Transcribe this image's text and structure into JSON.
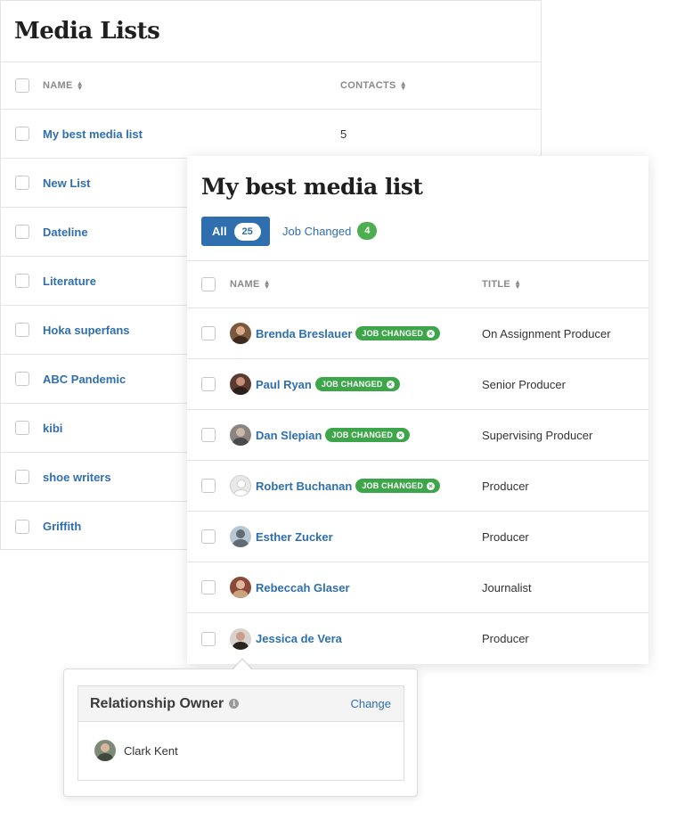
{
  "media_lists": {
    "title": "Media Lists",
    "columns": {
      "name": "NAME",
      "contacts": "CONTACTS"
    },
    "rows": [
      {
        "name": "My best media list",
        "contacts": "5"
      },
      {
        "name": "New List"
      },
      {
        "name": "Dateline"
      },
      {
        "name": "Literature"
      },
      {
        "name": "Hoka superfans"
      },
      {
        "name": "ABC Pandemic"
      },
      {
        "name": "kibi"
      },
      {
        "name": "shoe writers"
      },
      {
        "name": "Griffith"
      }
    ]
  },
  "detail": {
    "title": "My best media list",
    "tabs": {
      "all": {
        "label": "All",
        "count": "25"
      },
      "job_changed": {
        "label": "Job Changed",
        "count": "4"
      }
    },
    "columns": {
      "name": "NAME",
      "title": "TITLE"
    },
    "badge_label": "JOB CHANGED",
    "contacts": [
      {
        "name": "Brenda Breslauer",
        "title": "On Assignment Producer",
        "job_changed": true
      },
      {
        "name": "Paul Ryan",
        "title": "Senior Producer",
        "job_changed": true
      },
      {
        "name": "Dan Slepian",
        "title": "Supervising Producer",
        "job_changed": true
      },
      {
        "name": "Robert Buchanan",
        "title": "Producer",
        "job_changed": true
      },
      {
        "name": "Esther Zucker",
        "title": "Producer",
        "job_changed": false
      },
      {
        "name": "Rebeccah Glaser",
        "title": "Journalist",
        "job_changed": false
      },
      {
        "name": "Jessica de Vera",
        "title": "Producer",
        "job_changed": false
      }
    ]
  },
  "relationship": {
    "title": "Relationship Owner",
    "change_label": "Change",
    "owner_name": "Clark Kent"
  },
  "colors": {
    "link_blue": "#2f6fb0",
    "badge_green": "#3ea64a",
    "count_green": "#4cae4f"
  },
  "icons": {
    "sort": "sort-icon",
    "info": "info-icon",
    "badge_close": "close-circle-icon"
  }
}
